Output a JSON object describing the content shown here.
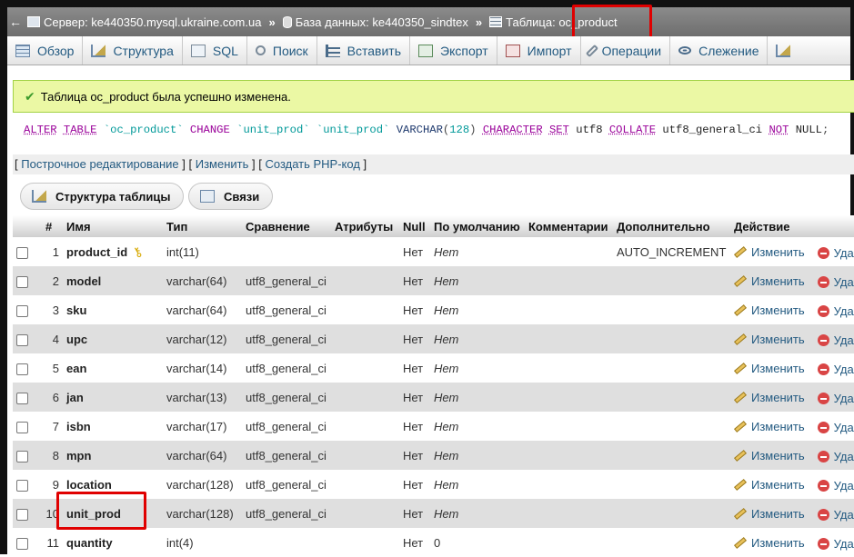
{
  "breadcrumb": {
    "server": "Сервер: ke440350.mysql.ukraine.com.ua",
    "database": "База данных: ke440350_sindtex",
    "table": "Таблица: oc_product"
  },
  "tabs": [
    {
      "label": "Обзор",
      "icon": "browse-icon"
    },
    {
      "label": "Структура",
      "icon": "structure-icon"
    },
    {
      "label": "SQL",
      "icon": "sql-icon"
    },
    {
      "label": "Поиск",
      "icon": "search-icon"
    },
    {
      "label": "Вставить",
      "icon": "insert-icon"
    },
    {
      "label": "Экспорт",
      "icon": "export-icon"
    },
    {
      "label": "Импорт",
      "icon": "import-icon"
    },
    {
      "label": "Операции",
      "icon": "operations-icon"
    },
    {
      "label": "Слежение",
      "icon": "tracking-icon"
    }
  ],
  "success_message": "Таблица oc_product была успешно изменена.",
  "sql_query": {
    "alter": "ALTER",
    "table": "TABLE",
    "table_name": "`oc_product`",
    "change": "CHANGE",
    "col_old": "`unit_prod`",
    "col_new": "`unit_prod`",
    "type": "VARCHAR",
    "length": "128",
    "character": "CHARACTER",
    "set": "SET",
    "charset": "utf8",
    "collate": "COLLATE",
    "collation": "utf8_general_ci",
    "not": "NOT",
    "null": "NULL",
    "end": ";"
  },
  "links": {
    "inline_edit": "Построчное редактирование",
    "edit": "Изменить",
    "create_php": "Создать PHP-код"
  },
  "buttons": {
    "table_structure": "Структура таблицы",
    "relations": "Связи"
  },
  "columns": {
    "num": "#",
    "name": "Имя",
    "type": "Тип",
    "collation": "Сравнение",
    "attributes": "Атрибуты",
    "null": "Null",
    "default": "По умолчанию",
    "comments": "Комментарии",
    "extra": "Дополнительно",
    "action": "Действие"
  },
  "actions": {
    "edit": "Изменить",
    "drop": "Удалить"
  },
  "rows": [
    {
      "num": "1",
      "name": "product_id",
      "type": "int(11)",
      "collation": "",
      "null": "Нет",
      "default": "Нет",
      "extra": "AUTO_INCREMENT",
      "primary": true
    },
    {
      "num": "2",
      "name": "model",
      "type": "varchar(64)",
      "collation": "utf8_general_ci",
      "null": "Нет",
      "default": "Нет",
      "extra": ""
    },
    {
      "num": "3",
      "name": "sku",
      "type": "varchar(64)",
      "collation": "utf8_general_ci",
      "null": "Нет",
      "default": "Нет",
      "extra": ""
    },
    {
      "num": "4",
      "name": "upc",
      "type": "varchar(12)",
      "collation": "utf8_general_ci",
      "null": "Нет",
      "default": "Нет",
      "extra": ""
    },
    {
      "num": "5",
      "name": "ean",
      "type": "varchar(14)",
      "collation": "utf8_general_ci",
      "null": "Нет",
      "default": "Нет",
      "extra": ""
    },
    {
      "num": "6",
      "name": "jan",
      "type": "varchar(13)",
      "collation": "utf8_general_ci",
      "null": "Нет",
      "default": "Нет",
      "extra": ""
    },
    {
      "num": "7",
      "name": "isbn",
      "type": "varchar(17)",
      "collation": "utf8_general_ci",
      "null": "Нет",
      "default": "Нет",
      "extra": ""
    },
    {
      "num": "8",
      "name": "mpn",
      "type": "varchar(64)",
      "collation": "utf8_general_ci",
      "null": "Нет",
      "default": "Нет",
      "extra": ""
    },
    {
      "num": "9",
      "name": "location",
      "type": "varchar(128)",
      "collation": "utf8_general_ci",
      "null": "Нет",
      "default": "Нет",
      "extra": ""
    },
    {
      "num": "10",
      "name": "unit_prod",
      "type": "varchar(128)",
      "collation": "utf8_general_ci",
      "null": "Нет",
      "default": "Нет",
      "extra": ""
    },
    {
      "num": "11",
      "name": "quantity",
      "type": "int(4)",
      "collation": "",
      "null": "Нет",
      "default": "0",
      "extra": "",
      "default_plain": true
    }
  ],
  "colors": {
    "link": "#235a81",
    "success_bg": "#ebf8a4",
    "highlight": "#e00000"
  }
}
